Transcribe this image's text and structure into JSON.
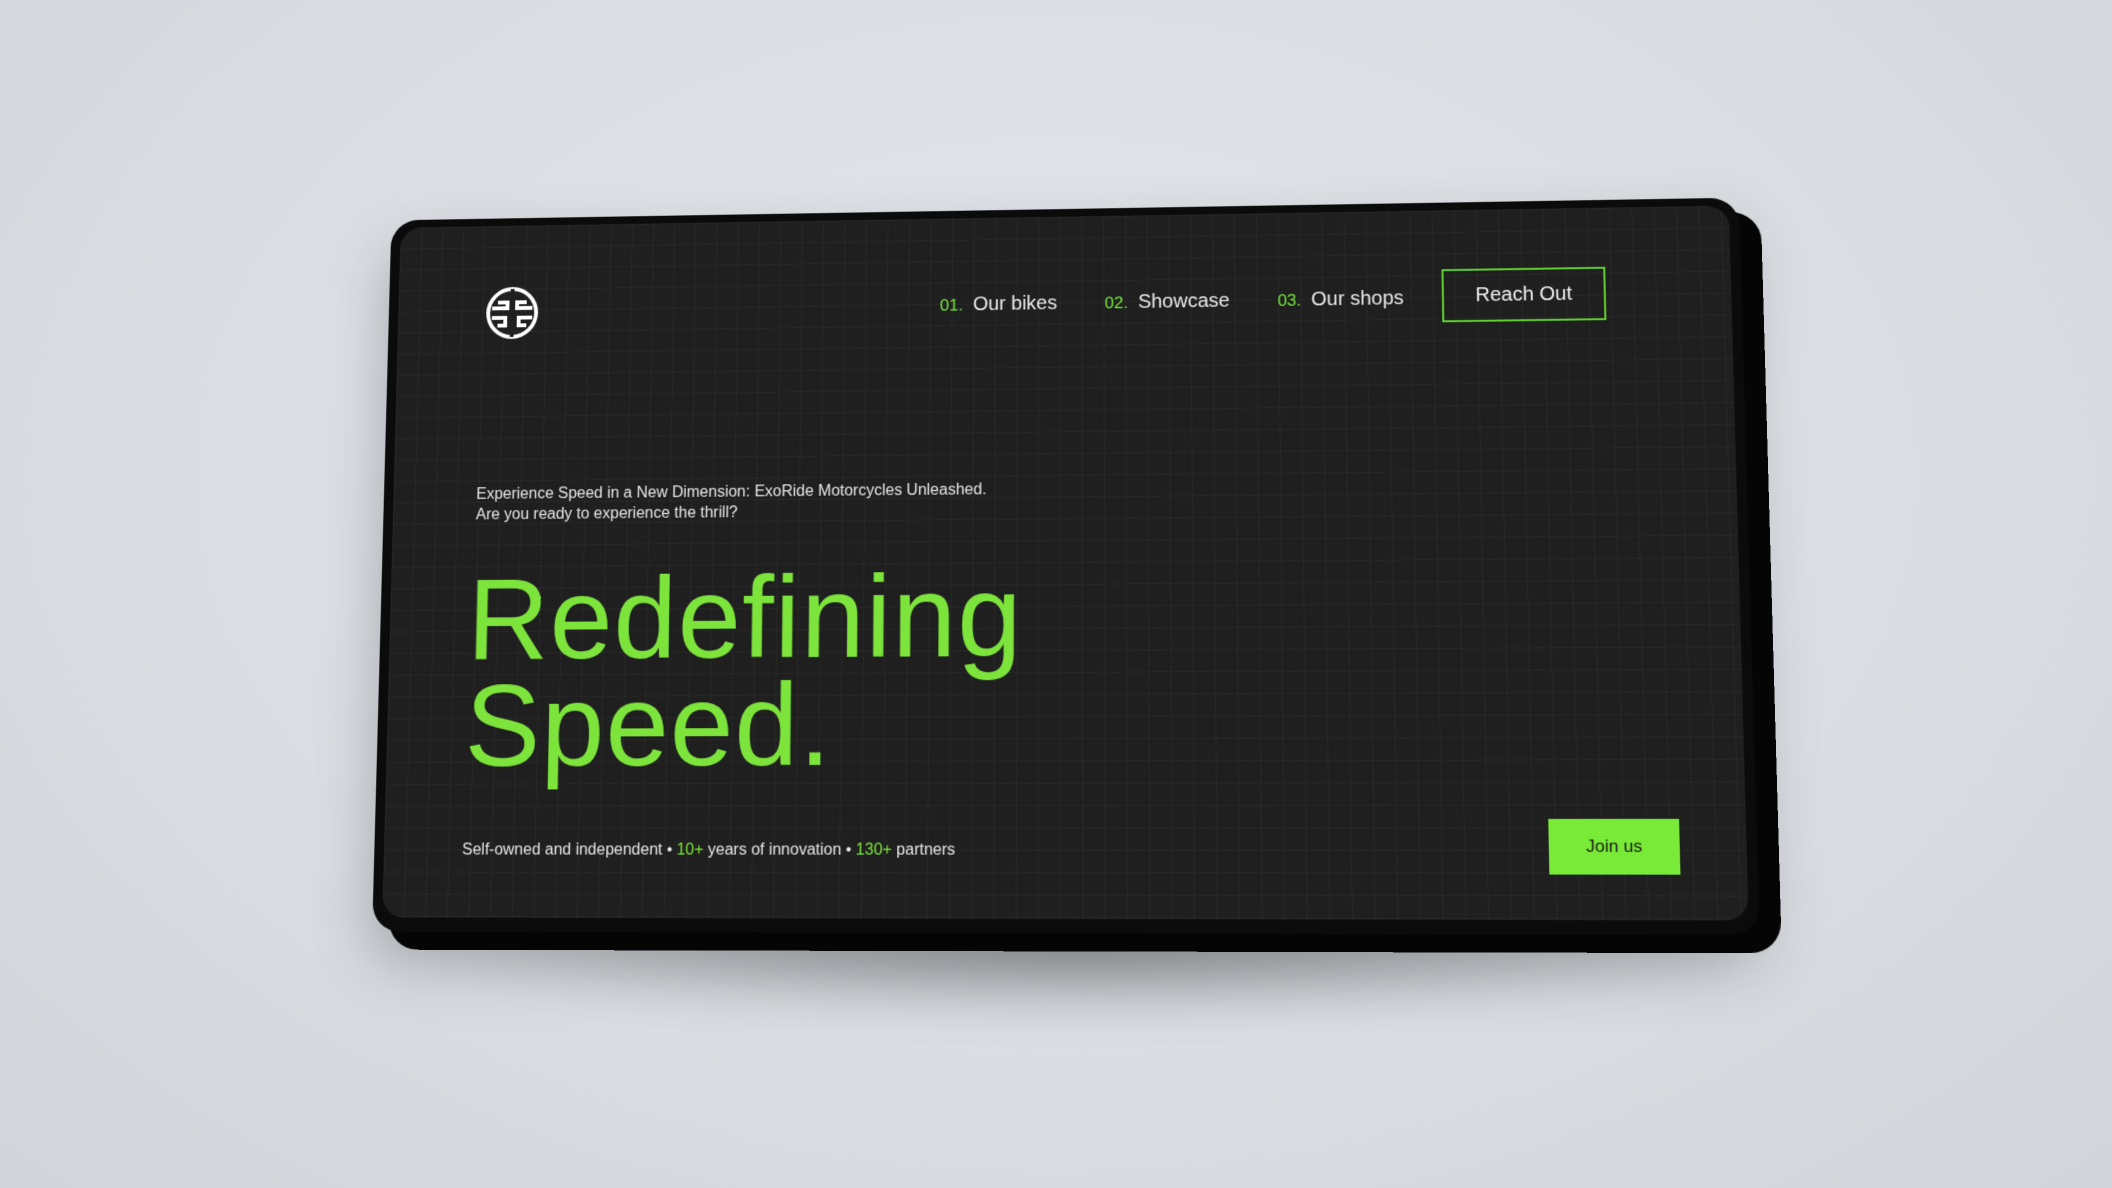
{
  "brand": {
    "logo_icon": "abstract-emblem-icon",
    "accent_color": "#7de43c",
    "background_color": "#1f1f1f"
  },
  "nav": {
    "items": [
      {
        "num": "01.",
        "label": "Our bikes"
      },
      {
        "num": "02.",
        "label": "Showcase"
      },
      {
        "num": "03.",
        "label": "Our shops"
      }
    ],
    "cta_label": "Reach Out"
  },
  "hero": {
    "intro_line1": "Experience Speed in a New Dimension: ExoRide Motorcycles Unleashed.",
    "intro_line2": "Are you ready to experience the thrill?",
    "headline_line1": "Redefining",
    "headline_line2": "Speed."
  },
  "stats": {
    "part1": "Self-owned and independent • ",
    "years_value": "10+",
    "part2": " years of innovation • ",
    "partners_value": "130+",
    "part3": " partners"
  },
  "join_label": "Join us"
}
